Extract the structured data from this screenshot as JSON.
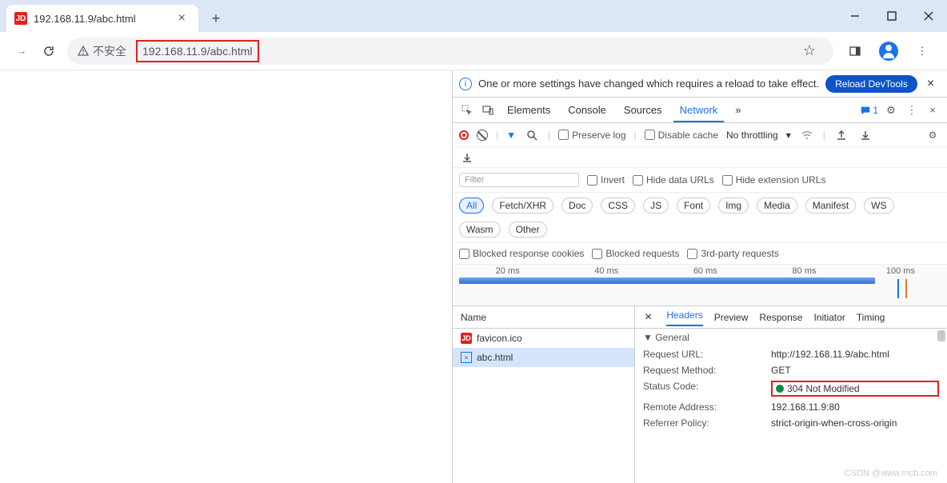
{
  "tab": {
    "favicon_text": "JD",
    "title": "192.168.11.9/abc.html"
  },
  "addr": {
    "insecure_label": "不安全",
    "url": "192.168.11.9/abc.html"
  },
  "banner": {
    "msg": "One or more settings have changed which requires a reload to take effect.",
    "reload": "Reload DevTools"
  },
  "devtabs": {
    "elements": "Elements",
    "console": "Console",
    "sources": "Sources",
    "network": "Network",
    "more": "»",
    "msgcount": "1"
  },
  "netbar": {
    "preserve": "Preserve log",
    "disable": "Disable cache",
    "throttling": "No throttling"
  },
  "filter": {
    "placeholder": "Filter",
    "invert": "Invert",
    "hide_data": "Hide data URLs",
    "hide_ext": "Hide extension URLs",
    "blocked_cookies": "Blocked response cookies",
    "blocked_req": "Blocked requests",
    "third": "3rd-party requests",
    "types": [
      "All",
      "Fetch/XHR",
      "Doc",
      "CSS",
      "JS",
      "Font",
      "Img",
      "Media",
      "Manifest",
      "WS",
      "Wasm",
      "Other"
    ]
  },
  "timeline": {
    "t1": "20 ms",
    "t2": "40 ms",
    "t3": "60 ms",
    "t4": "80 ms",
    "t5": "100 ms"
  },
  "reqlist": {
    "header": "Name",
    "items": [
      {
        "icon": "JD",
        "name": "favicon.ico",
        "selected": false
      },
      {
        "icon": "≡",
        "name": "abc.html",
        "selected": true
      }
    ]
  },
  "detail": {
    "tabs": {
      "headers": "Headers",
      "preview": "Preview",
      "response": "Response",
      "initiator": "Initiator",
      "timing": "Timing"
    },
    "section": "General",
    "rows": [
      {
        "k": "Request URL:",
        "v": "http://192.168.11.9/abc.html"
      },
      {
        "k": "Request Method:",
        "v": "GET"
      },
      {
        "k": "Status Code:",
        "v": "304 Not Modified",
        "status": true
      },
      {
        "k": "Remote Address:",
        "v": "192.168.11.9:80"
      },
      {
        "k": "Referrer Policy:",
        "v": "strict-origin-when-cross-origin"
      }
    ]
  },
  "watermark": "CSDN @www.mcb.com"
}
